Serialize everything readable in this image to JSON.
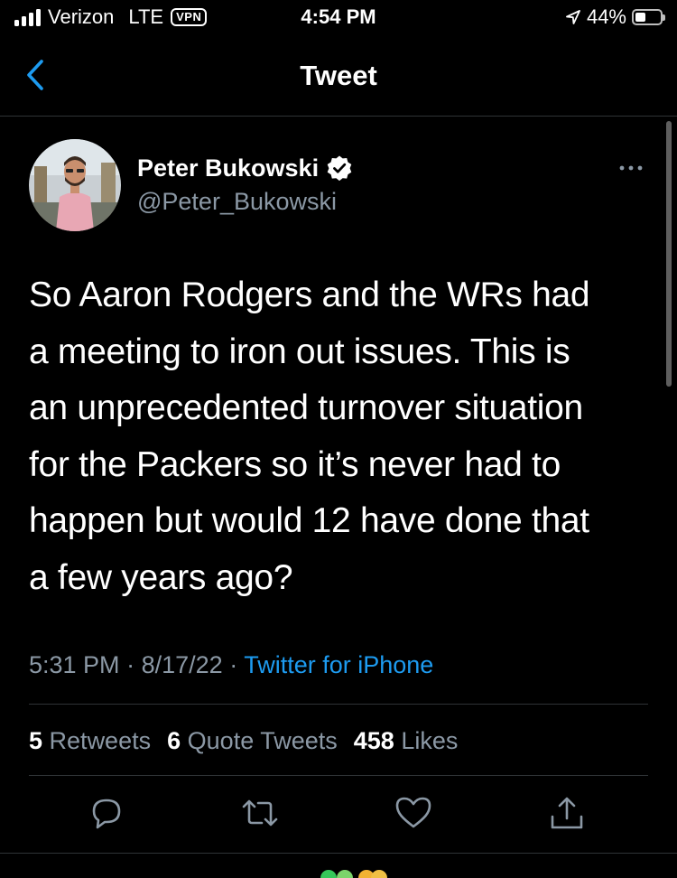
{
  "status_bar": {
    "carrier": "Verizon",
    "network": "LTE",
    "vpn": "VPN",
    "time": "4:54 PM",
    "battery_percent": "44%",
    "battery_level": 0.44,
    "icons": [
      "signal-bars-icon",
      "location-arrow-icon",
      "battery-icon"
    ]
  },
  "nav": {
    "title": "Tweet",
    "back_icon": "chevron-left-icon"
  },
  "tweet": {
    "author_name": "Peter Bukowski",
    "author_handle": "@Peter_Bukowski",
    "verified": true,
    "text": "So Aaron Rodgers and the WRs had\na meeting to iron out issues. This is\nan unprecedented turnover situation\nfor the Packers so it’s never had to\nhappen but would 12 have done that\na few years ago?",
    "time": "5:31 PM",
    "date": "8/17/22",
    "separator": "·",
    "source": "Twitter for iPhone",
    "stats": [
      {
        "count": "5",
        "label": "Retweets"
      },
      {
        "count": "6",
        "label": "Quote Tweets"
      },
      {
        "count": "458",
        "label": "Likes"
      }
    ],
    "actions": [
      "reply-icon",
      "retweet-icon",
      "like-icon",
      "share-icon"
    ]
  },
  "colors": {
    "background": "#000000",
    "text_primary": "#ffffff",
    "text_secondary": "#8b98a5",
    "accent": "#1d9bf0",
    "divider": "#2f3336"
  }
}
